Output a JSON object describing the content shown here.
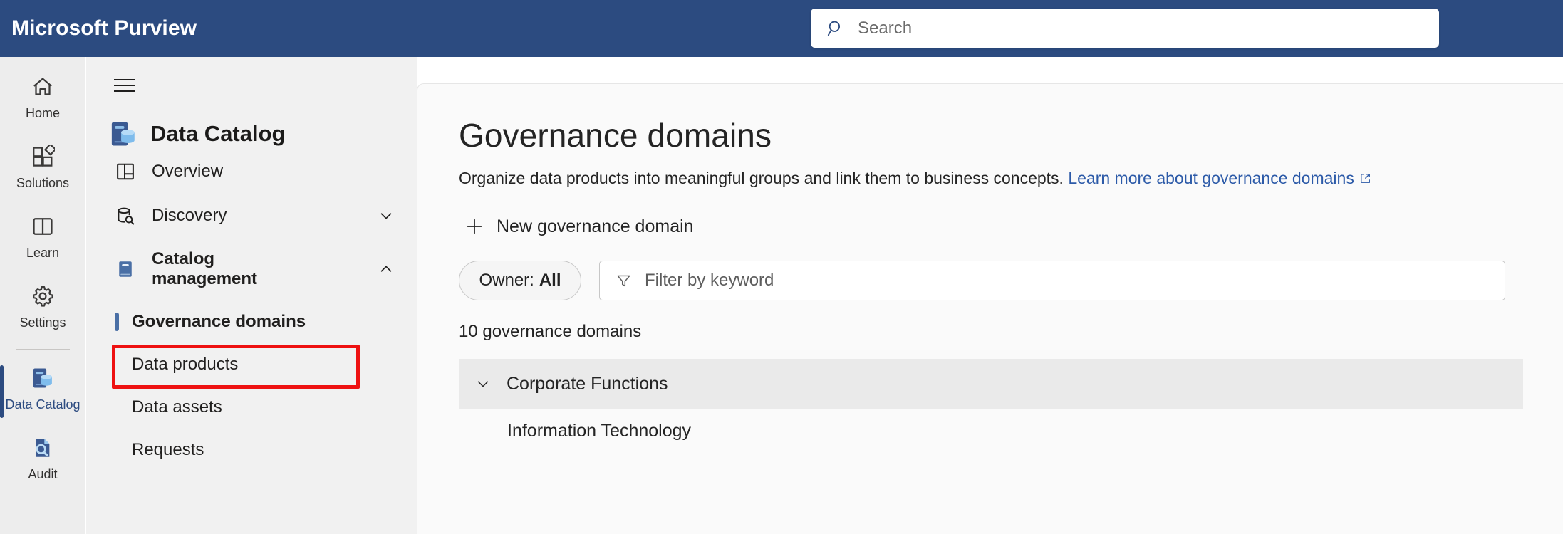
{
  "suite": {
    "brand": "Microsoft Purview",
    "search_placeholder": "Search",
    "search_icon": "search-icon",
    "bar_color": "#2C4B80"
  },
  "rail": {
    "items": [
      {
        "label": "Home",
        "icon": "home-icon",
        "selected": false
      },
      {
        "label": "Solutions",
        "icon": "solutions-grid-icon",
        "selected": false
      },
      {
        "label": "Learn",
        "icon": "book-open-icon",
        "selected": false
      },
      {
        "label": "Settings",
        "icon": "gear-icon",
        "selected": false
      },
      {
        "label": "Data Catalog",
        "icon": "data-catalog-icon",
        "selected": true
      },
      {
        "label": "Audit",
        "icon": "audit-magnifier-icon",
        "selected": false
      }
    ]
  },
  "nav": {
    "menu_icon": "hamburger-icon",
    "title": "Data Catalog",
    "title_icon": "data-catalog-icon",
    "items": [
      {
        "label": "Overview",
        "icon": "dashboard-grid-icon",
        "chevron": null,
        "bold": false
      },
      {
        "label": "Discovery",
        "icon": "database-search-icon",
        "chevron": "chevron-down-icon",
        "bold": false
      },
      {
        "label": "Catalog management",
        "icon": "book-filled-icon",
        "chevron": "chevron-up-icon",
        "bold": true
      }
    ],
    "sub_items": [
      {
        "label": "Governance domains",
        "active": true,
        "highlighted": true
      },
      {
        "label": "Data products",
        "active": false,
        "highlighted": false
      },
      {
        "label": "Data assets",
        "active": false,
        "highlighted": false
      },
      {
        "label": "Requests",
        "active": false,
        "highlighted": false
      }
    ],
    "highlight_color": "#EE1111",
    "selection_color": "#4A6FA5"
  },
  "main": {
    "title": "Governance domains",
    "subtitle": "Organize data products into meaningful groups and link them to business concepts.",
    "link_text": "Learn more about governance domains",
    "link_icon": "external-link-icon",
    "new_button": {
      "label": "New governance domain",
      "icon": "plus-icon"
    },
    "filters": {
      "owner_label": "Owner:",
      "owner_value": "All",
      "keyword_placeholder": "Filter by keyword",
      "keyword_icon": "funnel-icon"
    },
    "count_text": "10 governance domains",
    "groups": [
      {
        "label": "Corporate Functions",
        "chevron": "chevron-down-icon",
        "domains": [
          {
            "label": "Information Technology"
          }
        ]
      }
    ]
  }
}
